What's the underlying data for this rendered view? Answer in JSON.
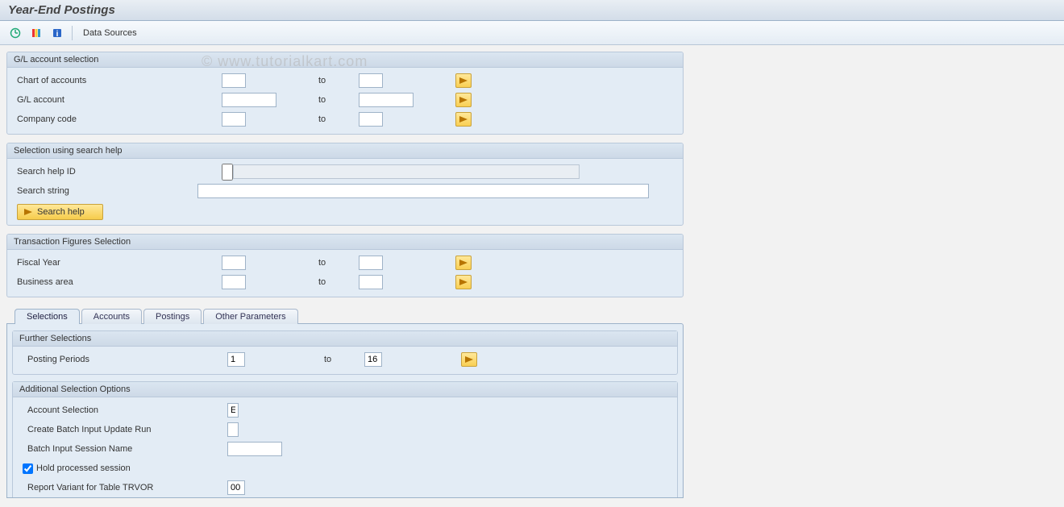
{
  "title": "Year-End Postings",
  "watermark": "© www.tutorialkart.com",
  "toolbar": {
    "data_sources": "Data Sources"
  },
  "groups": {
    "gl": {
      "title": "G/L account selection",
      "chart_of_accounts_label": "Chart of accounts",
      "gl_account_label": "G/L account",
      "company_code_label": "Company code",
      "to": "to"
    },
    "search": {
      "title": "Selection using search help",
      "search_help_id_label": "Search help ID",
      "search_string_label": "Search string",
      "search_help_btn": "Search help"
    },
    "trans": {
      "title": "Transaction Figures Selection",
      "fiscal_year_label": "Fiscal Year",
      "business_area_label": "Business area",
      "to": "to"
    }
  },
  "tabs": {
    "selections": "Selections",
    "accounts": "Accounts",
    "postings": "Postings",
    "other": "Other Parameters"
  },
  "further": {
    "title": "Further Selections",
    "posting_periods_label": "Posting Periods",
    "posting_periods_from": "1",
    "posting_periods_to": "16",
    "to": "to"
  },
  "addl": {
    "title": "Additional Selection Options",
    "account_selection_label": "Account Selection",
    "account_selection_value": "E",
    "create_batch_label": "Create Batch Input Update Run",
    "batch_session_label": "Batch Input Session Name",
    "hold_processed_label": "Hold processed session",
    "report_variant_label": "Report Variant for Table TRVOR",
    "report_variant_value": "00"
  }
}
